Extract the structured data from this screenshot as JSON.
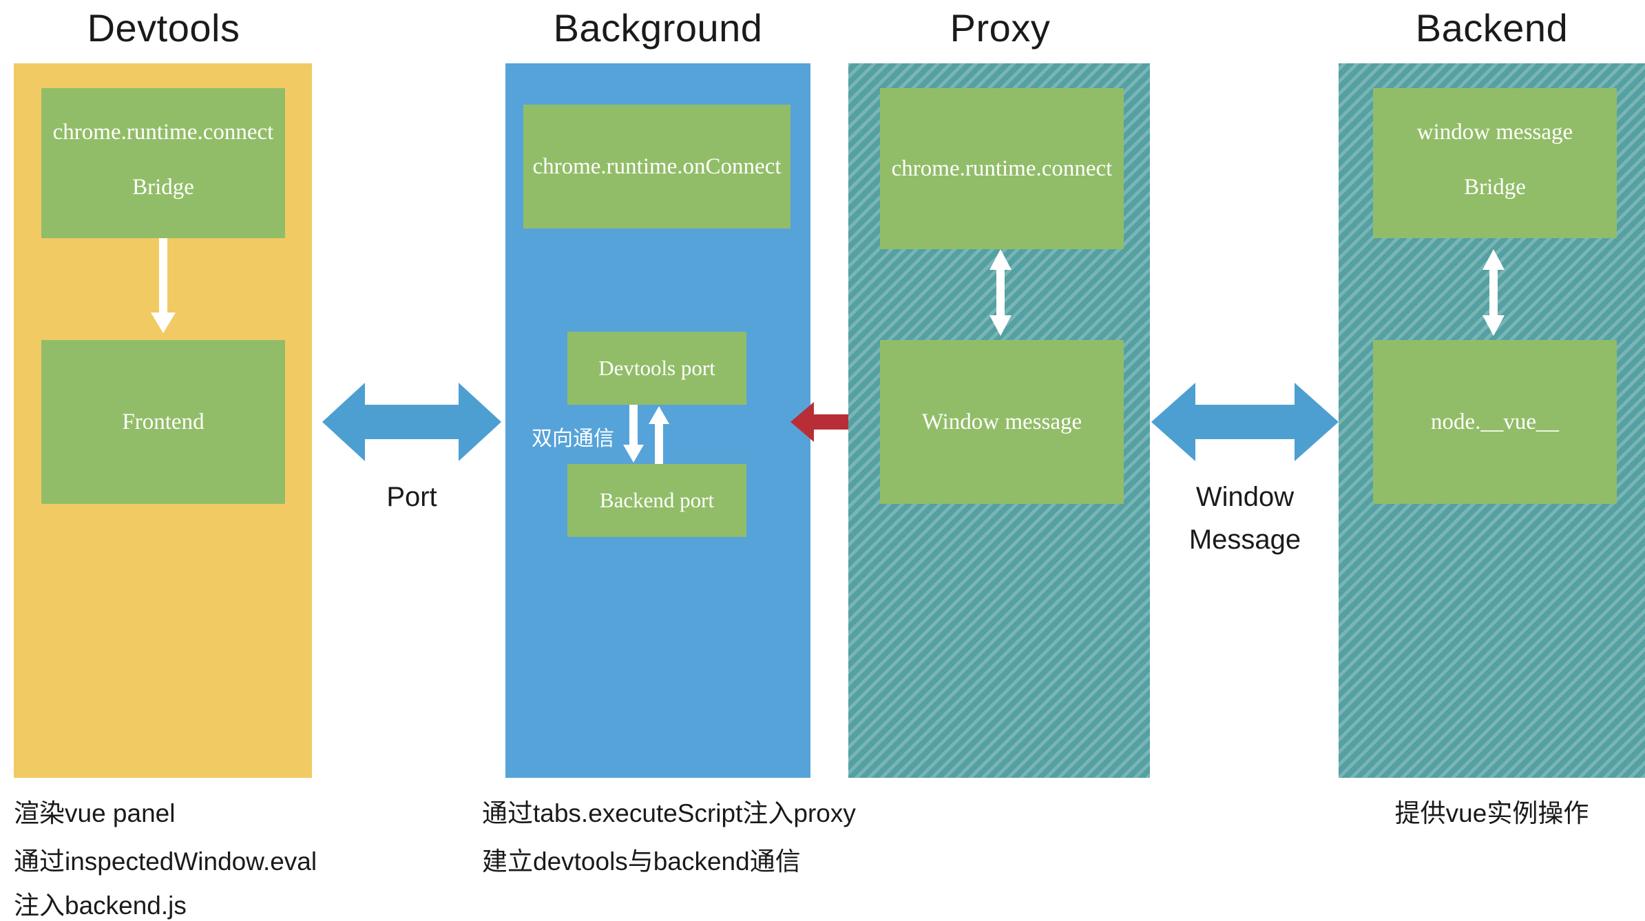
{
  "diagram": {
    "title_font_color": "#1a1a1a",
    "columns": [
      {
        "key": "devtools",
        "header": "Devtools",
        "fill_color": "#f2ca64",
        "pattern": "solid",
        "boxes": [
          {
            "key": "bridge",
            "lines": [
              "chrome.runtime.connect",
              "Bridge"
            ]
          },
          {
            "key": "frontend",
            "lines": [
              "Frontend"
            ]
          }
        ],
        "caption_lines": [
          "渲染vue panel",
          "通过inspectedWindow.eval",
          "注入backend.js"
        ]
      },
      {
        "key": "background",
        "header": "Background",
        "fill_color": "#56a3d9",
        "pattern": "solid",
        "boxes": [
          {
            "key": "on-connect",
            "lines": [
              "chrome.runtime.onConnect"
            ]
          },
          {
            "key": "devtools-port",
            "lines": [
              "Devtools port"
            ]
          },
          {
            "key": "backend-port",
            "lines": [
              "Backend port"
            ]
          }
        ],
        "inner_label": "双向通信",
        "caption_lines": [
          "通过tabs.executeScript注入proxy",
          "建立devtools与backend通信"
        ]
      },
      {
        "key": "proxy",
        "header": "Proxy",
        "fill_color": "#54a0a2",
        "pattern": "diagonal-stripes",
        "boxes": [
          {
            "key": "runtime-connect",
            "lines": [
              "chrome.runtime.connect"
            ]
          },
          {
            "key": "window-message",
            "lines": [
              "Window message"
            ]
          }
        ],
        "caption_lines": []
      },
      {
        "key": "backend",
        "header": "Backend",
        "fill_color": "#54a0a2",
        "pattern": "diagonal-stripes",
        "boxes": [
          {
            "key": "window-message-bridge",
            "lines": [
              "window message",
              "Bridge"
            ]
          },
          {
            "key": "node-vue",
            "lines": [
              "node.__vue__"
            ]
          }
        ],
        "caption_lines": [
          "提供vue实例操作"
        ]
      }
    ],
    "connectors": [
      {
        "key": "port",
        "label": "Port",
        "color": "#4e9fd1",
        "style": "double-horizontal"
      },
      {
        "key": "background-proxy",
        "label": "",
        "color": "#b92e36",
        "style": "double-horizontal"
      },
      {
        "key": "window-message",
        "label_lines": [
          "Window",
          "Message"
        ],
        "color": "#4e9fd1",
        "style": "double-horizontal"
      }
    ],
    "box_fill_color": "#92bd68",
    "arrow_white_color": "#ffffff"
  }
}
